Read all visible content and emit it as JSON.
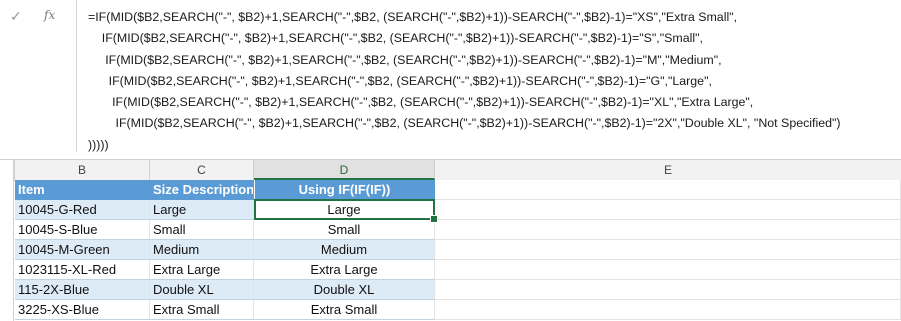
{
  "formula_bar": {
    "cancel_icon": "check-icon",
    "fx_label": "fx",
    "formula": "=IF(MID($B2,SEARCH(\"-\", $B2)+1,SEARCH(\"-\",$B2, (SEARCH(\"-\",$B2)+1))-SEARCH(\"-\",$B2)-1)=\"XS\",\"Extra Small\",\n    IF(MID($B2,SEARCH(\"-\", $B2)+1,SEARCH(\"-\",$B2, (SEARCH(\"-\",$B2)+1))-SEARCH(\"-\",$B2)-1)=\"S\",\"Small\",\n     IF(MID($B2,SEARCH(\"-\", $B2)+1,SEARCH(\"-\",$B2, (SEARCH(\"-\",$B2)+1))-SEARCH(\"-\",$B2)-1)=\"M\",\"Medium\",\n      IF(MID($B2,SEARCH(\"-\", $B2)+1,SEARCH(\"-\",$B2, (SEARCH(\"-\",$B2)+1))-SEARCH(\"-\",$B2)-1)=\"G\",\"Large\",\n       IF(MID($B2,SEARCH(\"-\", $B2)+1,SEARCH(\"-\",$B2, (SEARCH(\"-\",$B2)+1))-SEARCH(\"-\",$B2)-1)=\"XL\",\"Extra Large\",\n        IF(MID($B2,SEARCH(\"-\", $B2)+1,SEARCH(\"-\",$B2, (SEARCH(\"-\",$B2)+1))-SEARCH(\"-\",$B2)-1)=\"2X\",\"Double XL\", \"Not Specified\")\n))))) "
  },
  "columns": [
    "B",
    "C",
    "D",
    "E"
  ],
  "table": {
    "headers": [
      "Item",
      "Size Description",
      "Using IF(IF(IF))"
    ],
    "rows": [
      [
        "10045-G-Red",
        "Large",
        "Large"
      ],
      [
        "10045-S-Blue",
        "Small",
        "Small"
      ],
      [
        "10045-M-Green",
        "Medium",
        "Medium"
      ],
      [
        "1023115-XL-Red",
        "Extra Large",
        "Extra Large"
      ],
      [
        "115-2X-Blue",
        "Double XL",
        "Double XL"
      ],
      [
        "3225-XS-Blue",
        "Extra Small",
        "Extra Small"
      ]
    ]
  },
  "colors": {
    "header_blue": "#5b9bd5",
    "band_blue": "#ddebf7",
    "selection_green": "#217346"
  }
}
